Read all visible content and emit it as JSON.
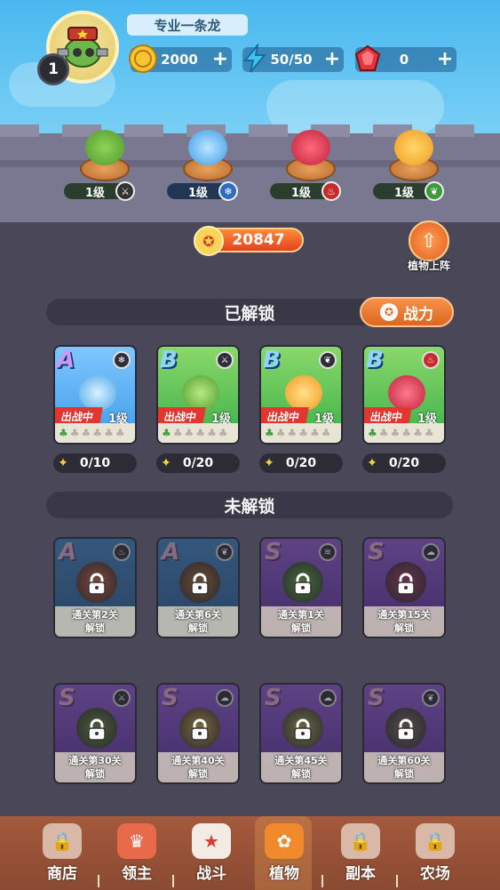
{
  "player": {
    "name": "专业一条龙",
    "level": "1"
  },
  "resources": [
    {
      "icon": "gold-coin-icon",
      "value": "2000"
    },
    {
      "icon": "energy-bolt-icon",
      "value": "50/50"
    },
    {
      "icon": "red-gem-icon",
      "value": "0"
    }
  ],
  "wall_slots": [
    {
      "level": "1级",
      "element": "sword-icon"
    },
    {
      "level": "1级",
      "element": "snowflake-icon"
    },
    {
      "level": "1级",
      "element": "fire-icon"
    },
    {
      "level": "1级",
      "element": "leaf-icon"
    }
  ],
  "power": {
    "value": "20847"
  },
  "deploy_button": {
    "label": "植物上阵"
  },
  "unlocked": {
    "title": "已解锁",
    "sort_label": "战力",
    "cards": [
      {
        "rank": "A",
        "element": "snowflake-icon",
        "status": "出战中",
        "level": "1级",
        "progress": "0/10",
        "color": "#3f9be8"
      },
      {
        "rank": "B",
        "element": "sword-icon",
        "status": "出战中",
        "level": "1级",
        "progress": "0/20",
        "color": "#3bb04a"
      },
      {
        "rank": "B",
        "element": "leaf-icon",
        "status": "出战中",
        "level": "1级",
        "progress": "0/20",
        "color": "#3bb04a"
      },
      {
        "rank": "B",
        "element": "fire-icon",
        "status": "出战中",
        "level": "1级",
        "progress": "0/20",
        "color": "#3bb04a"
      }
    ]
  },
  "locked": {
    "title": "未解锁",
    "unlock_word": "解锁",
    "cards": [
      {
        "rank": "A",
        "element": "fire-icon",
        "req": "通关第2关"
      },
      {
        "rank": "A",
        "element": "leaf-icon",
        "req": "通关第6关"
      },
      {
        "rank": "S",
        "element": "wind-icon",
        "req": "通关第1关"
      },
      {
        "rank": "S",
        "element": "cloud-icon",
        "req": "通关第15关"
      },
      {
        "rank": "S",
        "element": "sword-icon",
        "req": "通关第30关"
      },
      {
        "rank": "S",
        "element": "cloud-icon",
        "req": "通关第40关"
      },
      {
        "rank": "S",
        "element": "cloud-icon",
        "req": "通关第45关"
      },
      {
        "rank": "S",
        "element": "leaf-icon",
        "req": "通关第60关"
      }
    ]
  },
  "nav": [
    {
      "label": "商店"
    },
    {
      "label": "领主"
    },
    {
      "label": "战斗"
    },
    {
      "label": "植物"
    },
    {
      "label": "副本"
    },
    {
      "label": "农场"
    }
  ]
}
